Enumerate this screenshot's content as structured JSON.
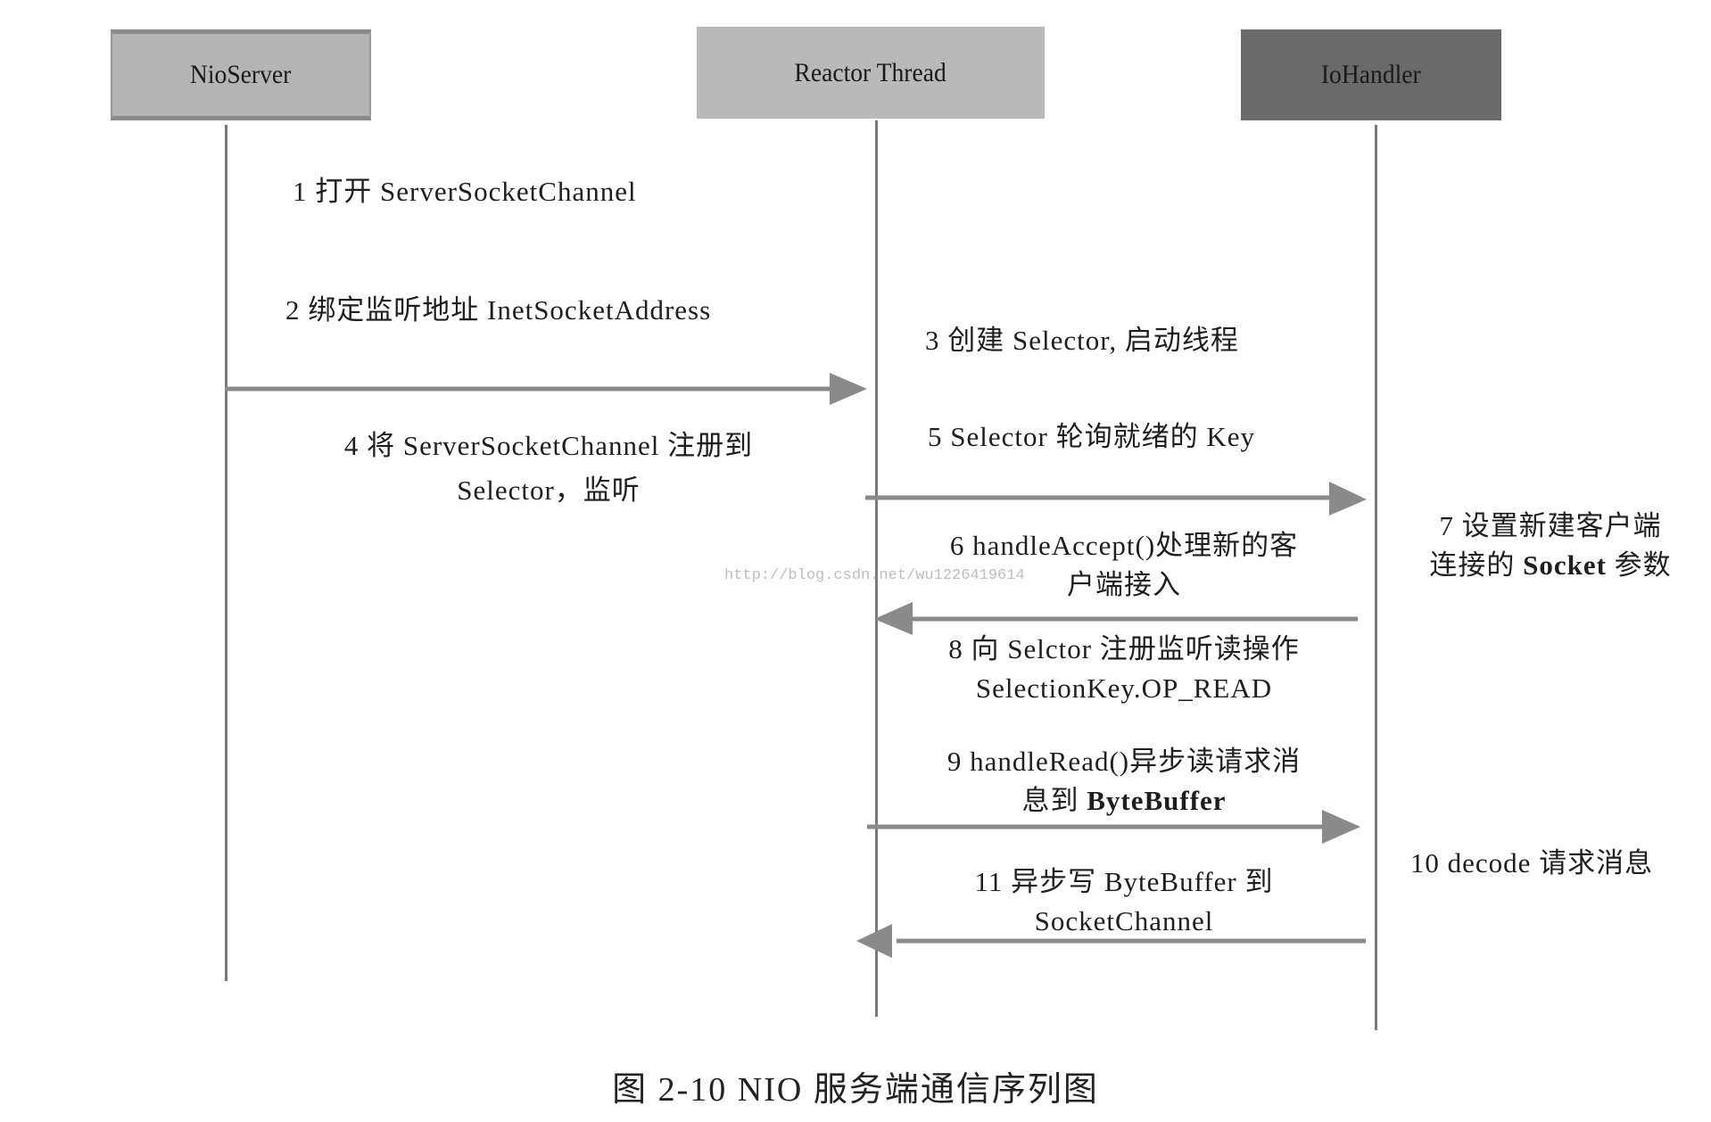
{
  "actors": [
    {
      "id": "nioserver",
      "label": "NioServer",
      "fill": "#b4b4b4"
    },
    {
      "id": "reactor",
      "label": "Reactor Thread",
      "fill": "#b9b9b9"
    },
    {
      "id": "iohandler",
      "label": "IoHandler",
      "fill": "#6a6a6a"
    }
  ],
  "messages": [
    {
      "step": "1",
      "text": "1  打开  ServerSocketChannel",
      "from": "nioserver",
      "to": "nioserver"
    },
    {
      "step": "2",
      "text": "2  绑定监听地址 InetSocketAddress",
      "from": "nioserver",
      "to": "nioserver"
    },
    {
      "step": "3",
      "text": "3  创建 Selector, 启动线程",
      "from": "reactor",
      "to": "reactor"
    },
    {
      "step": "4",
      "line1": "4  将  ServerSocketChannel  注册到",
      "line2": "Selector，监听",
      "from": "nioserver",
      "to": "reactor"
    },
    {
      "step": "5",
      "text": "5 Selector 轮询就绪的 Key",
      "from": "reactor",
      "to": "iohandler"
    },
    {
      "step": "6",
      "line1": "6 handleAccept()处理新的客",
      "line2": "户端接入",
      "from": "iohandler",
      "to": "reactor"
    },
    {
      "step": "7",
      "line1": "7  设置新建客户端",
      "line2_pre": "连接的 ",
      "line2_bold": "Socket",
      "line2_post": " 参数",
      "from": "iohandler",
      "to": "iohandler"
    },
    {
      "step": "8",
      "line1": "8  向 Selctor 注册监听读操作",
      "line2": "SelectionKey.OP_READ",
      "from": "iohandler",
      "to": "reactor"
    },
    {
      "step": "9",
      "line1": "9 handleRead()异步读请求消",
      "line2_pre": "息到 ",
      "line2_bold": "ByteBuffer",
      "from": "reactor",
      "to": "iohandler"
    },
    {
      "step": "10",
      "text": "10 decode  请求消息",
      "from": "iohandler",
      "to": "iohandler"
    },
    {
      "step": "11",
      "line1": "11  异步写 ByteBuffer 到",
      "line2": "SocketChannel",
      "from": "iohandler",
      "to": "reactor"
    }
  ],
  "watermark": "http://blog.csdn.net/wu1226419614",
  "caption": "图 2-10    NIO 服务端通信序列图"
}
